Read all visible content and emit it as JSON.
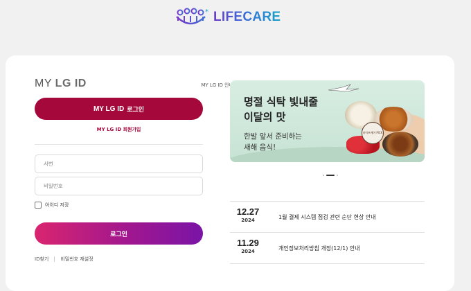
{
  "header": {
    "brand": "LIFECARE",
    "logo_icon": "people-icon"
  },
  "login": {
    "title_prefix": "MY",
    "title_brand": "LG ID",
    "guide_link": "MY LG ID 안내",
    "mylgid_button_brand": "MY LG ID",
    "mylgid_button_label": "로그인",
    "join_link": "MY LG ID 회원가입",
    "id_placeholder": "사번",
    "pw_placeholder": "비밀번호",
    "remember_label": "아이디 저장",
    "login_button": "로그인",
    "find_id": "ID찾기",
    "reset_pw": "비밀번호 재설정"
  },
  "banner": {
    "title": "명절 식탁 빛내줄\n이달의 맛",
    "subtitle": "한발 앞서 준비하는\n새해 음식!",
    "badge": "라이프케어 PICK",
    "slide_count": 3,
    "active_slide": 2
  },
  "notices": [
    {
      "date": "12.27",
      "year": "2024",
      "title": "1월 결제 시스템 점검 관련 순단 현상 안내"
    },
    {
      "date": "11.29",
      "year": "2024",
      "title": "개인정보처리방침 개정(12/1) 안내"
    }
  ],
  "colors": {
    "brand_burgundy": "#a5093c",
    "login_gradient_start": "#d9256f",
    "login_gradient_end": "#7a14a6",
    "logo_purple": "#6a3cc8",
    "logo_teal": "#1aa1c9"
  }
}
